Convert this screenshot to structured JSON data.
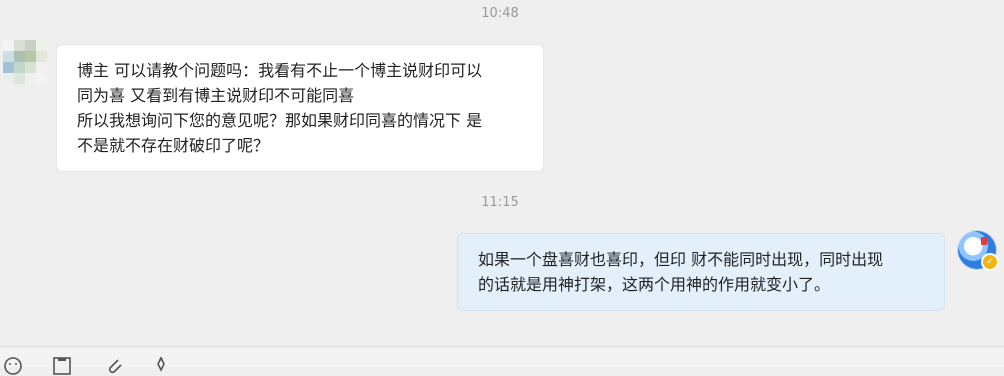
{
  "chat": {
    "timestamps": [
      "10:48",
      "11:15"
    ],
    "messages": [
      {
        "side": "left",
        "lines": [
          "博主 可以请教个问题吗：我看有不止一个博主说财印可以",
          "同为喜 又看到有博主说财印不可能同喜",
          "所以我想询问下您的意见呢？那如果财印同喜的情况下 是",
          "不是就不存在财破印了呢？"
        ]
      },
      {
        "side": "right",
        "lines": [
          "如果一个盘喜财也喜印，但印 财不能同时出现，同时出现",
          "的话就是用神打架，这两个用神的作用就变小了。"
        ]
      }
    ]
  },
  "colors": {
    "background": "#efefef",
    "left_bubble": "#ffffff",
    "right_bubble": "#e3f0fb",
    "timestamp_text": "#9a9a9a",
    "badge": "#f5b614",
    "avatar_blue": "#2f7fe0"
  },
  "icons": {
    "toolbar": [
      "emoji-icon",
      "screenshot-icon",
      "attachment-icon",
      "more-icon"
    ],
    "avatar_badge": "verified-badge-icon"
  }
}
